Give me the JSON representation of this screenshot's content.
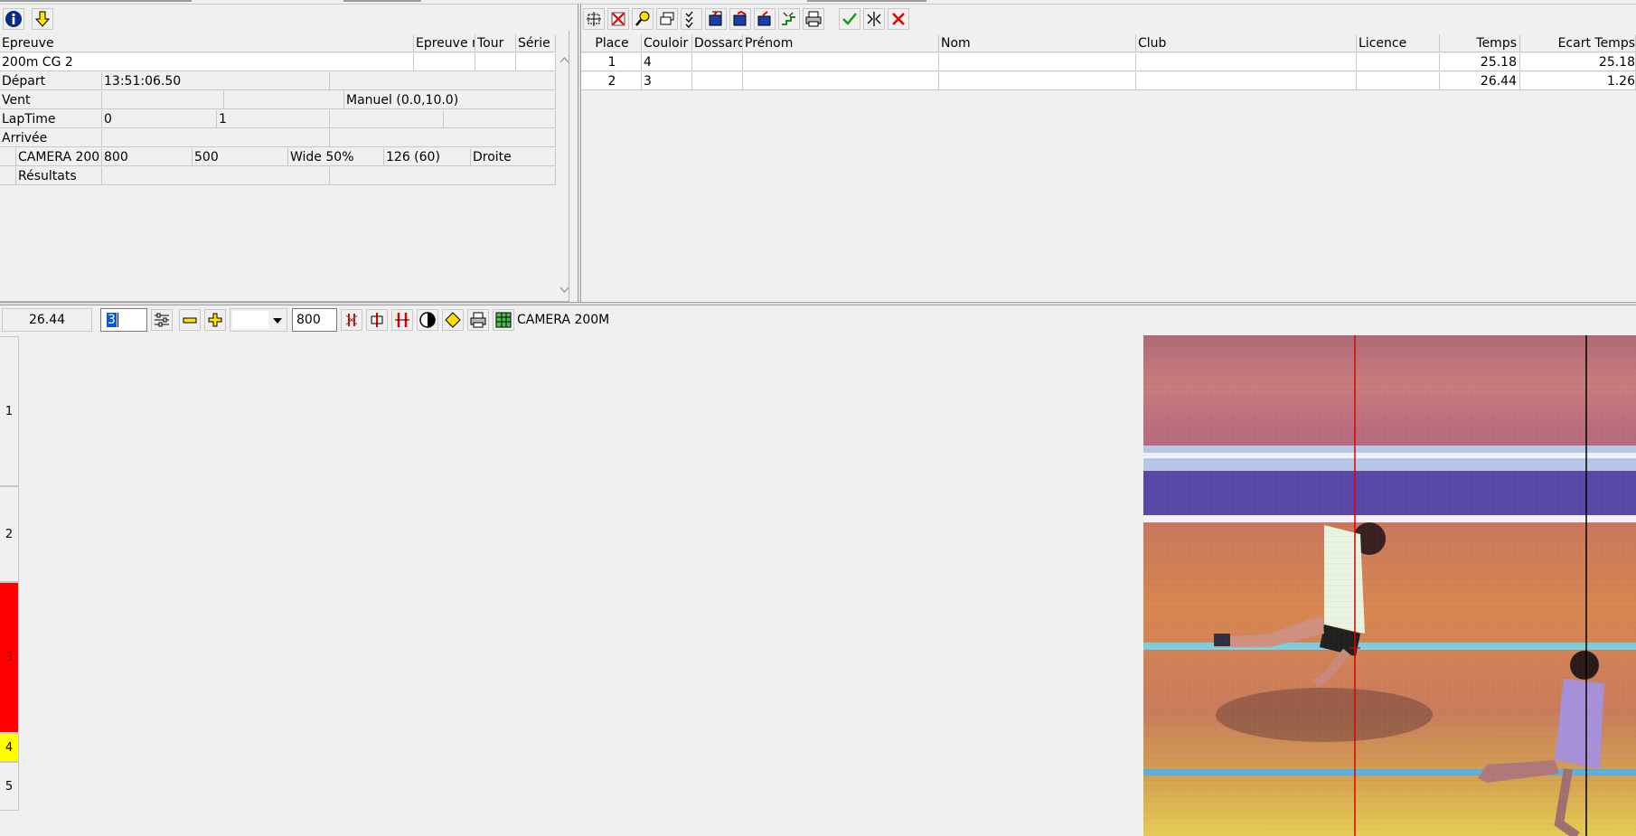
{
  "left_toolbar": {
    "info_icon": "info-icon",
    "download_icon": "arrow-down-icon"
  },
  "event_grid": {
    "headers": {
      "epreuve": "Epreuve",
      "epreuve_n": "Epreuve n",
      "tour": "Tour",
      "serie": "Série"
    },
    "event_name": "200m CG 2",
    "depart_label": "Départ",
    "depart_value": "13:51:06.50",
    "vent_label": "Vent",
    "vent_value": "Manuel (0.0,10.0)",
    "laptime_label": "LapTime",
    "laptime_a": "0",
    "laptime_b": "1",
    "arrivee_label": "Arrivée",
    "camera_label": "CAMERA 200",
    "camera_v1": "800",
    "camera_v2": "500",
    "camera_v3": "Wide 50%",
    "camera_v4": "126  (60)",
    "camera_v5": "Droite",
    "resultats_label": "Résultats"
  },
  "results_table": {
    "headers": {
      "place": "Place",
      "couloir": "Couloir",
      "dossard": "Dossard",
      "prenom": "Prénom",
      "nom": "Nom",
      "club": "Club",
      "licence": "Licence",
      "temps": "Temps",
      "ecart": "Ecart Temps"
    },
    "rows": [
      {
        "place": "1",
        "couloir": "4",
        "dossard": "",
        "prenom": "",
        "nom": "",
        "club": "",
        "licence": "",
        "temps": "25.18",
        "ecart": "25.18"
      },
      {
        "place": "2",
        "couloir": "3",
        "dossard": "",
        "prenom": "",
        "nom": "",
        "club": "",
        "licence": "",
        "temps": "26.44",
        "ecart": "1.26"
      }
    ]
  },
  "photo_toolbar": {
    "time_value": "26.44",
    "lane_input": "3",
    "zoom_select": "",
    "width_input": "800",
    "camera_name": "CAMERA 200M"
  },
  "lanes": [
    "1",
    "2",
    "3",
    "4",
    "5"
  ],
  "colors": {
    "selected_lane": "#ff0000",
    "lane4": "#ffff00",
    "accent_blue": "#0a2a8a",
    "yellow_icon": "#ffe000"
  }
}
